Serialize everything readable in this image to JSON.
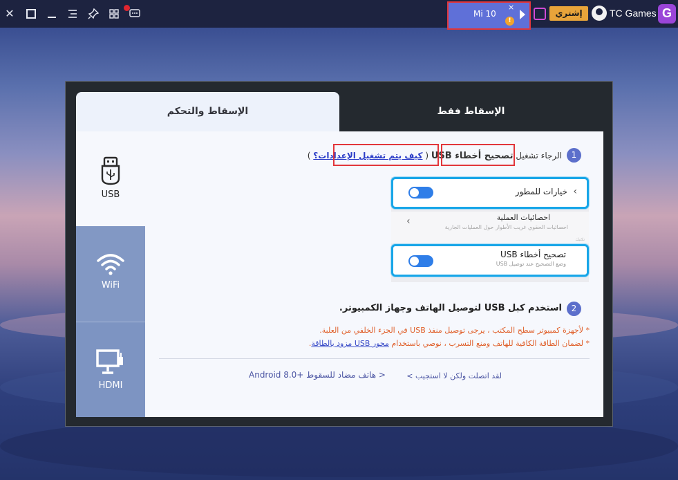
{
  "topbar": {
    "icons": [
      "close-icon",
      "fullscreen-icon",
      "minimize-icon",
      "menu-icon",
      "pin-icon",
      "grid-icon",
      "chat-icon"
    ],
    "device_tab": {
      "name": "Mi 10",
      "close": "×",
      "warning": "!"
    },
    "buy_badge": "إشتري",
    "brand": "TC Games",
    "logo_letter": "G"
  },
  "tabs": {
    "active": "الإسقاط والتحكم",
    "inactive": "الإسقاط فقط"
  },
  "sidebar": {
    "items": [
      {
        "label": "USB",
        "icon": "usb-icon"
      },
      {
        "label": "WiFi",
        "icon": "wifi-icon"
      },
      {
        "label": "HDMI",
        "icon": "monitor-icon"
      }
    ]
  },
  "step1": {
    "num": "1",
    "prefix": "الرجاء تشغيل",
    "bold": "تصحيح أخطاء USB",
    "paren_open": "(",
    "link": "كيف يتم تشغيل الإعدادات؟",
    "paren_close": ")"
  },
  "mock": {
    "row1_title": "خيارات للمطور",
    "mid_title": "احصائيات العملية",
    "mid_sub": "احصائيات الحقوي غريب الأطوار حول العمليات الجارية",
    "tiny": "تكتيك",
    "row2_title": "تصحيح أخطاء USB",
    "row2_sub": "وضع التصحيح عند توصيل USB"
  },
  "step2": {
    "num": "2",
    "text": "استخدم كبل USB لتوصيل الهاتف وجهاز الكمبيوتر.",
    "note1": "* لأجهزة كمبيوتر سطح المكتب ، يرجى توصيل منفذ USB في الجزء الخلفي من العلبة.",
    "note2_prefix": "* لضمان الطاقة الكافية للهاتف ومنع التسرب ، نوصي باستخدام",
    "note2_link": "محور USB مزود بالطاقة",
    "note2_suffix": "."
  },
  "footer": {
    "link_a": "لقد اتصلت ولكن لا استجيب >",
    "link_b": "Android 8.0+ هاتف مضاد للسقوط >"
  }
}
